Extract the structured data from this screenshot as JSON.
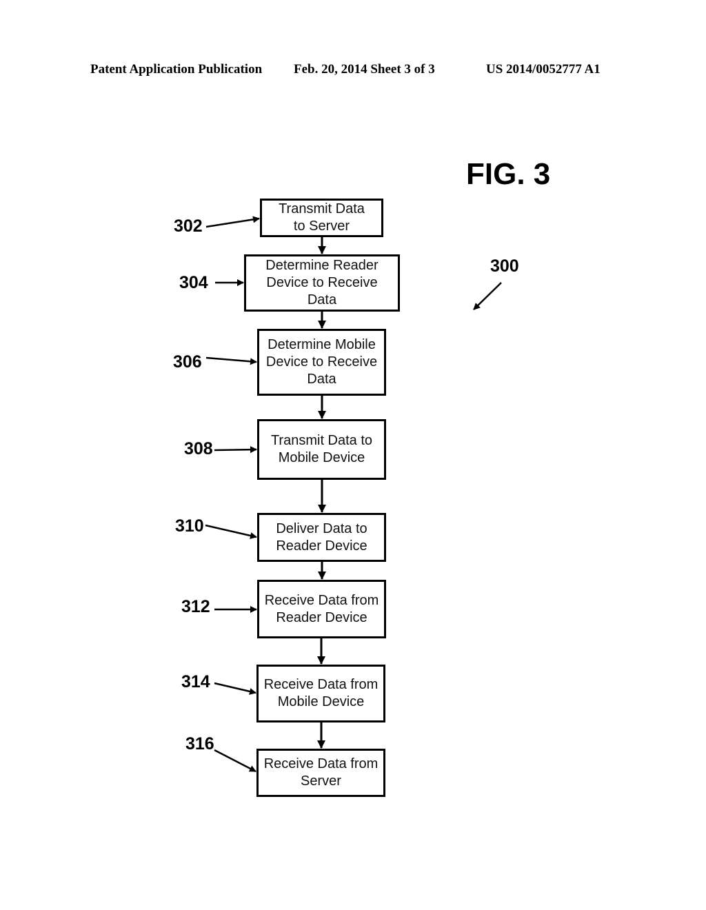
{
  "header": {
    "publication_type": "Patent Application Publication",
    "date_sheet": "Feb. 20, 2014   Sheet 3 of 3",
    "publication_number": "US 2014/0052777 A1"
  },
  "figure": {
    "title": "FIG. 3",
    "reference": "300"
  },
  "steps": [
    {
      "ref": "302",
      "label": "Transmit Data\nto Server"
    },
    {
      "ref": "304",
      "label": "Determine Reader\nDevice to Receive\nData"
    },
    {
      "ref": "306",
      "label": "Determine Mobile\nDevice to Receive\nData"
    },
    {
      "ref": "308",
      "label": "Transmit Data to\nMobile Device"
    },
    {
      "ref": "310",
      "label": "Deliver Data to\nReader Device"
    },
    {
      "ref": "312",
      "label": "Receive Data from\nReader Device"
    },
    {
      "ref": "314",
      "label": "Receive Data from\nMobile Device"
    },
    {
      "ref": "316",
      "label": "Receive Data from\nServer"
    }
  ]
}
